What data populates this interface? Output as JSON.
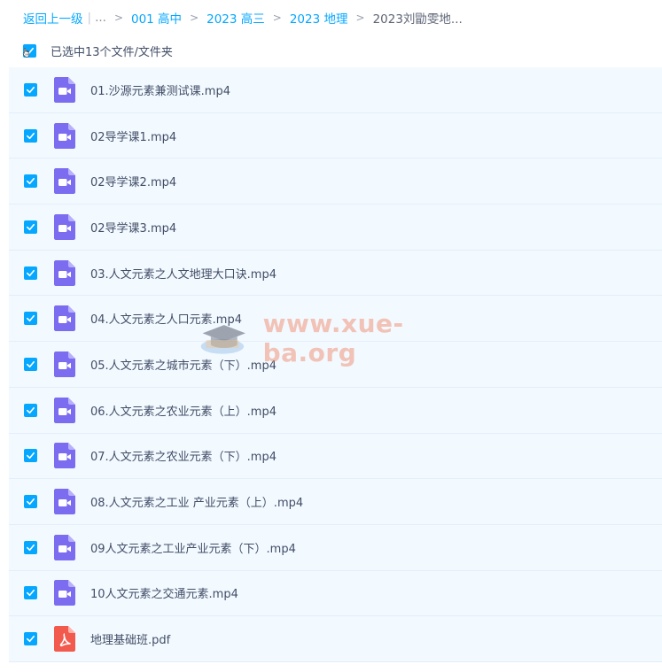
{
  "breadcrumb": {
    "back": "返回上一级",
    "ellipsis": "...",
    "items": [
      "001 高中",
      "2023 高三",
      "2023 地理"
    ],
    "current": "2023刘勖雯地..."
  },
  "selection": {
    "text": "已选中13个文件/文件夹",
    "checked": true
  },
  "files": [
    {
      "name": "01.沙源元素兼测试课.mp4",
      "type": "video",
      "checked": true
    },
    {
      "name": "02导学课1.mp4",
      "type": "video",
      "checked": true
    },
    {
      "name": "02导学课2.mp4",
      "type": "video",
      "checked": true
    },
    {
      "name": "02导学课3.mp4",
      "type": "video",
      "checked": true
    },
    {
      "name": "03.人文元素之人文地理大口诀.mp4",
      "type": "video",
      "checked": true
    },
    {
      "name": "04.人文元素之人口元素.mp4",
      "type": "video",
      "checked": true
    },
    {
      "name": "05.人文元素之城市元素（下）.mp4",
      "type": "video",
      "checked": true
    },
    {
      "name": "06.人文元素之农业元素（上）.mp4",
      "type": "video",
      "checked": true
    },
    {
      "name": "07.人文元素之农业元素（下）.mp4",
      "type": "video",
      "checked": true
    },
    {
      "name": "08.人文元素之工业 产业元素（上）.mp4",
      "type": "video",
      "checked": true
    },
    {
      "name": "09人文元素之工业产业元素（下）.mp4",
      "type": "video",
      "checked": true
    },
    {
      "name": "10人文元素之交通元素.mp4",
      "type": "video",
      "checked": true
    },
    {
      "name": "地理基础班.pdf",
      "type": "pdf",
      "checked": true
    }
  ],
  "watermark": "www.xue-ba.org",
  "colors": {
    "accent": "#06a7ff",
    "row_bg": "#f2f9ff",
    "video_icon": "#7b6cf0",
    "pdf_icon": "#f25a4e"
  }
}
